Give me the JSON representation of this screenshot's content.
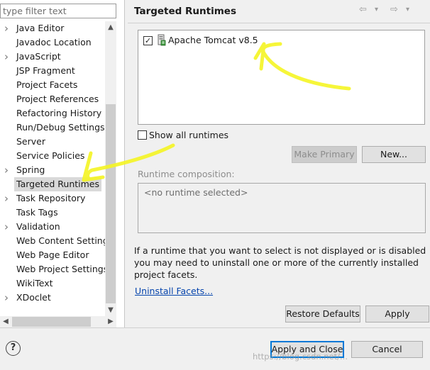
{
  "filter": {
    "placeholder": "type filter text"
  },
  "tree": {
    "items": [
      {
        "label": "Java Editor",
        "expandable": true
      },
      {
        "label": "Javadoc Location",
        "expandable": false
      },
      {
        "label": "JavaScript",
        "expandable": true
      },
      {
        "label": "JSP Fragment",
        "expandable": false
      },
      {
        "label": "Project Facets",
        "expandable": false
      },
      {
        "label": "Project References",
        "expandable": false
      },
      {
        "label": "Refactoring History",
        "expandable": false
      },
      {
        "label": "Run/Debug Settings",
        "expandable": false
      },
      {
        "label": "Server",
        "expandable": false
      },
      {
        "label": "Service Policies",
        "expandable": false
      },
      {
        "label": "Spring",
        "expandable": true
      },
      {
        "label": "Targeted Runtimes",
        "expandable": false,
        "selected": true
      },
      {
        "label": "Task Repository",
        "expandable": true
      },
      {
        "label": "Task Tags",
        "expandable": false
      },
      {
        "label": "Validation",
        "expandable": true
      },
      {
        "label": "Web Content Settings",
        "expandable": false
      },
      {
        "label": "Web Page Editor",
        "expandable": false
      },
      {
        "label": "Web Project Settings",
        "expandable": false
      },
      {
        "label": "WikiText",
        "expandable": false
      },
      {
        "label": "XDoclet",
        "expandable": true
      }
    ]
  },
  "page": {
    "title": "Targeted Runtimes"
  },
  "nav": {
    "back": "⇦",
    "back_menu": "▾",
    "forward": "⇨",
    "forward_menu": "▾"
  },
  "runtimes": {
    "items": [
      {
        "label": "Apache Tomcat v8.5",
        "checked": true,
        "check_mark": "✓"
      }
    ]
  },
  "show_all": {
    "label": "Show all runtimes",
    "checked": false
  },
  "buttons": {
    "make_primary": "Make Primary",
    "new": "New...",
    "restore_defaults": "Restore Defaults",
    "apply": "Apply",
    "apply_and_close": "Apply and Close",
    "cancel": "Cancel"
  },
  "composition": {
    "label": "Runtime composition:",
    "empty_text": "<no runtime selected>"
  },
  "info": {
    "text": "If a runtime that you want to select is not displayed or is disabled you may need to uninstall one or more of the currently installed project facets.",
    "uninstall_link": "Uninstall Facets..."
  },
  "help": {
    "glyph": "?"
  },
  "watermark": {
    "text": "https://blog.csdn.net/..."
  },
  "colors": {
    "annotation": "#f5f523",
    "selection": "#d9d9d9",
    "link": "#0645ad",
    "default_button_border": "#0078d7"
  }
}
